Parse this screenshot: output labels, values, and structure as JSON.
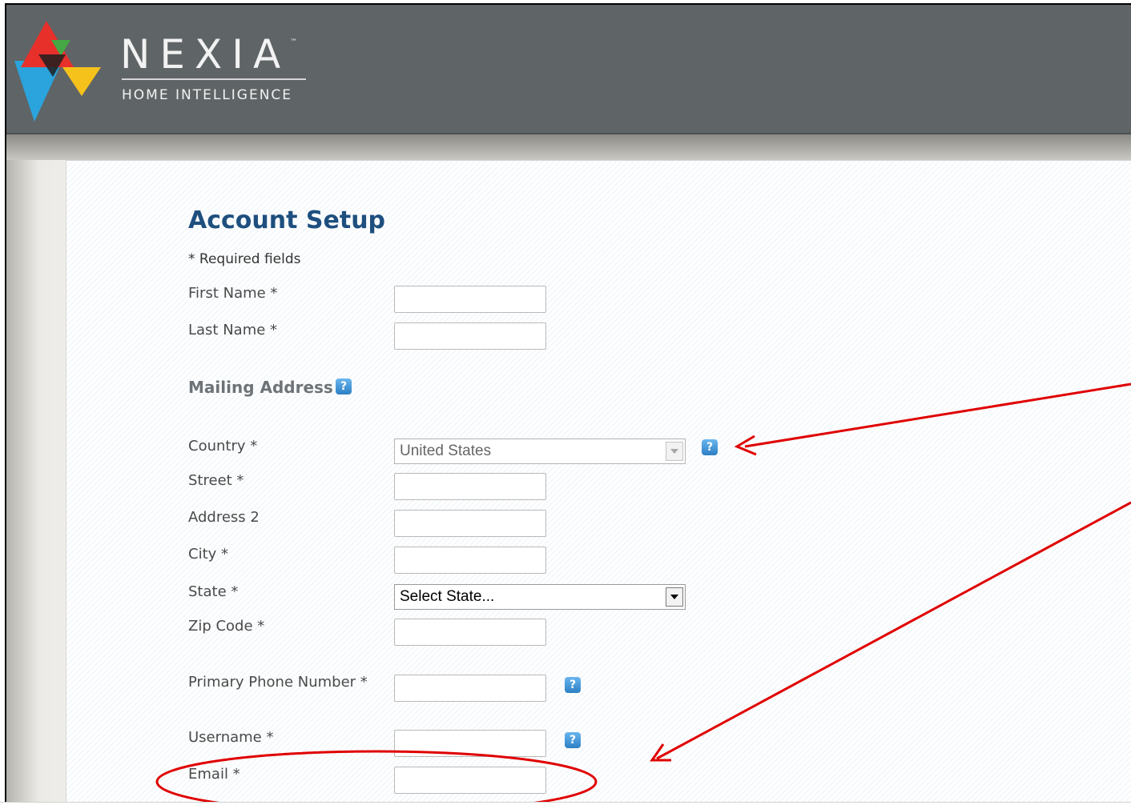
{
  "brand": {
    "name": "NEXIA",
    "trademark": "™",
    "tagline": "HOME INTELLIGENCE"
  },
  "form": {
    "title": "Account Setup",
    "required_note": "* Required fields",
    "fields": {
      "first_name": "First Name *",
      "last_name": "Last Name *",
      "mailing_address": "Mailing Address",
      "country": "Country *",
      "street": "Street *",
      "address2": "Address 2",
      "city": "City *",
      "state": "State *",
      "zip": "Zip Code *",
      "phone": "Primary Phone Number *",
      "username": "Username *",
      "email": "Email *"
    },
    "country_value": "United States",
    "state_value": "Select State..."
  },
  "icons": {
    "help": "?"
  },
  "colors": {
    "header_bg": "#5f6466",
    "title": "#1e4f7e",
    "help_icon": "#2d7fc4",
    "annotation": "#e00000"
  }
}
